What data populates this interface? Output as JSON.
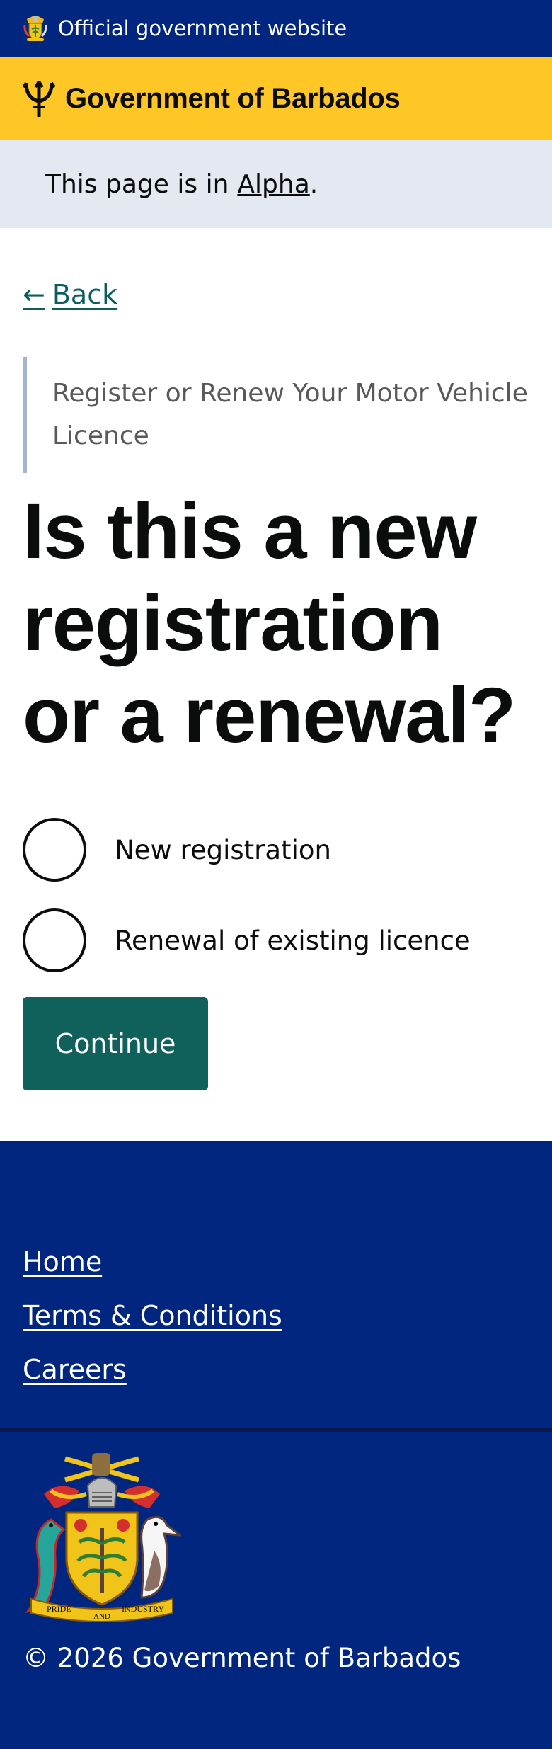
{
  "topbar": {
    "text": "Official government website"
  },
  "brand": {
    "name": "Government of Barbados"
  },
  "phase": {
    "prefix": "This page is in ",
    "link": "Alpha",
    "suffix": "."
  },
  "back": {
    "label": "Back",
    "arrow": "←"
  },
  "caption": "Register or Renew Your Motor Vehicle Licence",
  "heading": "Is this a new registration or a renewal?",
  "options": [
    {
      "label": "New registration",
      "selected": false
    },
    {
      "label": "Renewal of existing licence",
      "selected": false
    }
  ],
  "continue_label": "Continue",
  "footer": {
    "links": [
      "Home",
      "Terms & Conditions",
      "Careers"
    ],
    "coat_motto": [
      "PRIDE",
      "AND",
      "INDUSTRY"
    ],
    "copyright": "© 2026 Government of Barbados"
  },
  "colors": {
    "navy": "#00267f",
    "gold": "#ffc726",
    "phase_bg": "#e4e8f0",
    "teal": "#10605c",
    "back_link": "#0e5c5c"
  }
}
